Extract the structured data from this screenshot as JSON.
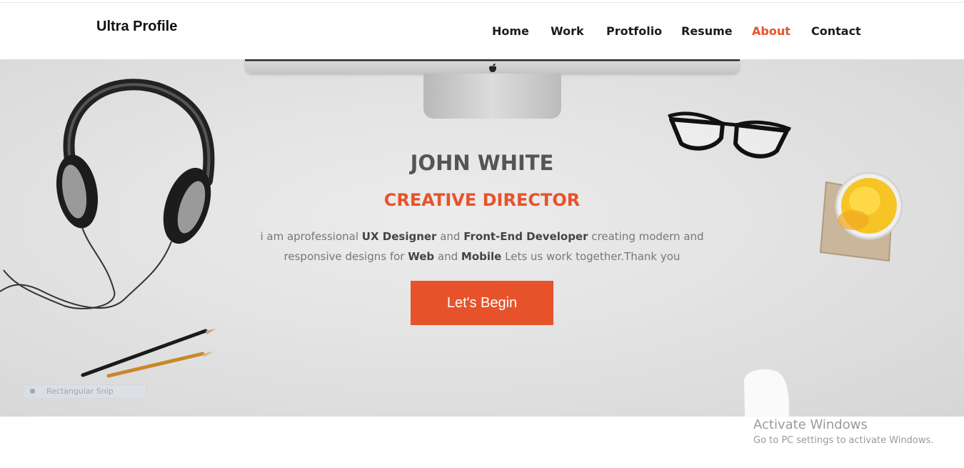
{
  "header": {
    "brand": "Ultra Profile",
    "nav": [
      {
        "label": "Home",
        "active": false
      },
      {
        "label": "Work",
        "active": false
      },
      {
        "label": "Protfolio",
        "active": false
      },
      {
        "label": "Resume",
        "active": false
      },
      {
        "label": "About",
        "active": true
      },
      {
        "label": "Contact",
        "active": false
      }
    ]
  },
  "hero": {
    "name": "JOHN WHITE",
    "role": "CREATIVE DIRECTOR",
    "description": {
      "p1": "i am aprofessional ",
      "b1": "UX Designer",
      "p2": " and ",
      "b2": "Front-End Developer",
      "p3": " creating modern and responsive designs for ",
      "b3": "Web",
      "p4": " and ",
      "b4": "Mobile",
      "p5": " Lets us work together.Thank you"
    },
    "cta_label": "Let's Begin"
  },
  "snip_tool": {
    "label": "Rectangular Snip"
  },
  "watermark": {
    "title": "Activate Windows",
    "subtitle": "Go to PC settings to activate Windows."
  },
  "colors": {
    "accent": "#e6532a",
    "text_dark": "#555555"
  },
  "icons": [
    "apple-logo-icon",
    "headphones-icon",
    "eyeglasses-icon",
    "juice-glass-icon",
    "pencil-icon",
    "mouse-icon"
  ]
}
